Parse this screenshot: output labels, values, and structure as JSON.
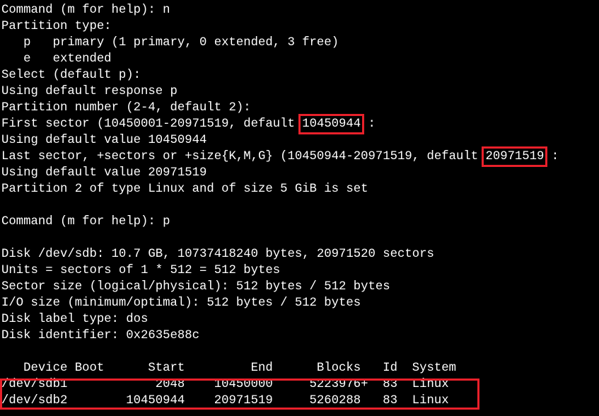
{
  "terminal": {
    "line1": "Command (m for help): n",
    "line2": "Partition type:",
    "line3": "   p   primary (1 primary, 0 extended, 3 free)",
    "line4": "   e   extended",
    "line5": "Select (default p):",
    "line6": "Using default response p",
    "line7": "Partition number (2-4, default 2):",
    "line8_prefix": "First sector (10450001-20971519, default ",
    "line8_highlight": "10450944",
    "line8_suffix": " :",
    "line9": "Using default value 10450944",
    "line10_prefix": "Last sector, +sectors or +size{K,M,G} (10450944-20971519, default ",
    "line10_highlight": "20971519",
    "line10_suffix": " :",
    "line11": "Using default value 20971519",
    "line12": "Partition 2 of type Linux and of size 5 GiB is set",
    "line13": "",
    "line14": "Command (m for help): p",
    "line15": "",
    "line16": "Disk /dev/sdb: 10.7 GB, 10737418240 bytes, 20971520 sectors",
    "line17": "Units = sectors of 1 * 512 = 512 bytes",
    "line18": "Sector size (logical/physical): 512 bytes / 512 bytes",
    "line19": "I/O size (minimum/optimal): 512 bytes / 512 bytes",
    "line20": "Disk label type: dos",
    "line21": "Disk identifier: 0x2635e88c",
    "line22": "",
    "table_header": "   Device Boot      Start         End      Blocks   Id  System",
    "table_rows": [
      "/dev/sdb1            2048    10450000     5223976+  83  Linux",
      "/dev/sdb2        10450944    20971519     5260288   83  Linux"
    ]
  },
  "colors": {
    "background": "#000000",
    "text": "#ffffff",
    "highlight_box": "#e8202a"
  }
}
